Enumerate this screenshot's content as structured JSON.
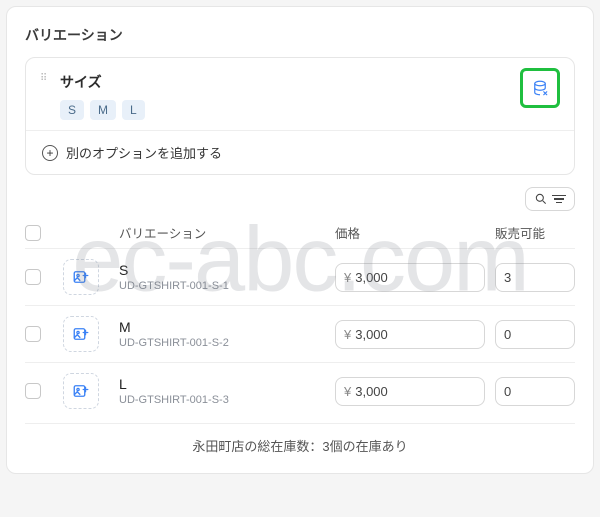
{
  "watermark": "ec-abc.com",
  "section": {
    "title": "バリエーション"
  },
  "option": {
    "name": "サイズ",
    "values": [
      "S",
      "M",
      "L"
    ]
  },
  "add_option_label": "別のオプションを追加する",
  "columns": {
    "variation": "バリエーション",
    "price": "価格",
    "available": "販売可能"
  },
  "currency": "¥",
  "variants": [
    {
      "name": "S",
      "sku": "UD-GTSHIRT-001-S-1",
      "price": "3,000",
      "qty": "3"
    },
    {
      "name": "M",
      "sku": "UD-GTSHIRT-001-S-2",
      "price": "3,000",
      "qty": "0"
    },
    {
      "name": "L",
      "sku": "UD-GTSHIRT-001-S-3",
      "price": "3,000",
      "qty": "0"
    }
  ],
  "stock_note": "永田町店の総在庫数：3個の在庫あり"
}
